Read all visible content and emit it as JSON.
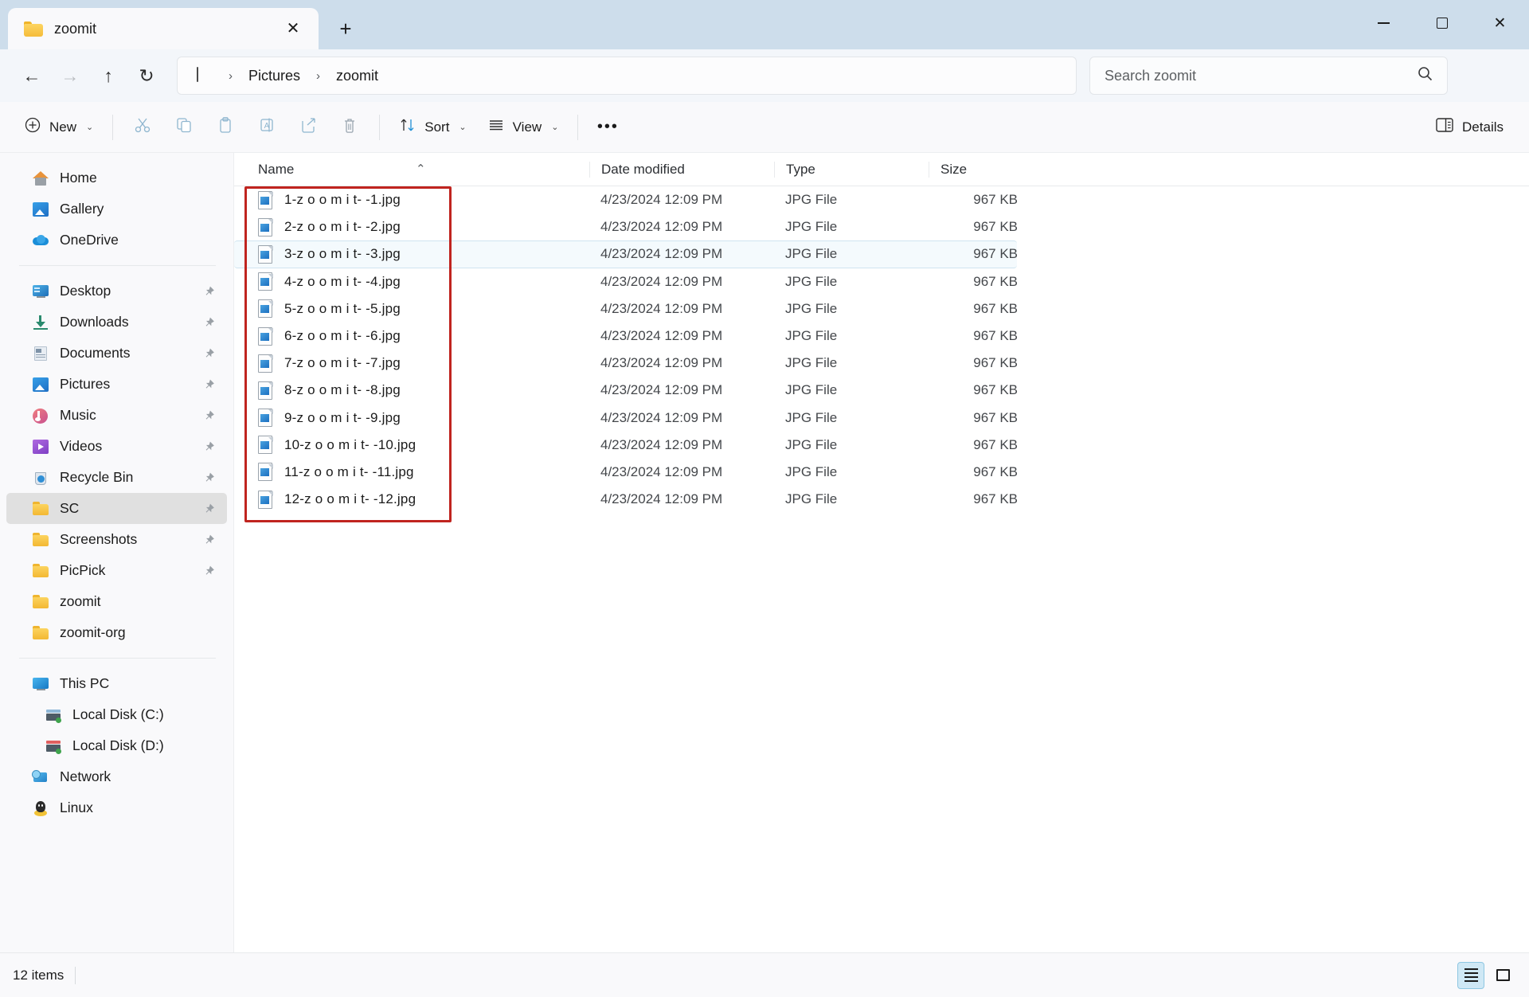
{
  "window": {
    "tab_title": "zoomit",
    "tab_icon": "folder-icon",
    "close_tab_label": "✕",
    "new_tab_label": "+",
    "minimize_label": "minimize",
    "maximize_label": "maximize",
    "close_label": "✕"
  },
  "address": {
    "back_label": "←",
    "forward_label": "→",
    "up_label": "↑",
    "refresh_label": "↻",
    "root_icon": "monitor-icon",
    "breadcrumbs": [
      "Pictures",
      "zoomit"
    ],
    "separator": "›"
  },
  "search": {
    "placeholder": "Search zoomit",
    "icon": "search-icon"
  },
  "toolbar": {
    "new_label": "New",
    "cut_label": "Cut",
    "copy_label": "Copy",
    "paste_label": "Paste",
    "rename_label": "Rename",
    "share_label": "Share",
    "delete_label": "Delete",
    "sort_label": "Sort",
    "view_label": "View",
    "more_label": "•••",
    "details_label": "Details",
    "chevron": "⌄"
  },
  "sidebar": {
    "groups": [
      {
        "items": [
          {
            "label": "Home",
            "icon": "home-icon",
            "pinned": false,
            "selected": false
          },
          {
            "label": "Gallery",
            "icon": "gallery-icon",
            "pinned": false,
            "selected": false
          },
          {
            "label": "OneDrive",
            "icon": "onedrive-icon",
            "pinned": false,
            "selected": false
          }
        ]
      },
      {
        "items": [
          {
            "label": "Desktop",
            "icon": "desktop-icon",
            "pinned": true,
            "selected": false
          },
          {
            "label": "Downloads",
            "icon": "downloads-icon",
            "pinned": true,
            "selected": false
          },
          {
            "label": "Documents",
            "icon": "documents-icon",
            "pinned": true,
            "selected": false
          },
          {
            "label": "Pictures",
            "icon": "pictures-icon",
            "pinned": true,
            "selected": false
          },
          {
            "label": "Music",
            "icon": "music-icon",
            "pinned": true,
            "selected": false
          },
          {
            "label": "Videos",
            "icon": "videos-icon",
            "pinned": true,
            "selected": false
          },
          {
            "label": "Recycle Bin",
            "icon": "recycle-bin-icon",
            "pinned": true,
            "selected": false
          },
          {
            "label": "SC",
            "icon": "folder-icon",
            "pinned": true,
            "selected": true
          },
          {
            "label": "Screenshots",
            "icon": "folder-icon",
            "pinned": true,
            "selected": false
          },
          {
            "label": "PicPick",
            "icon": "folder-icon",
            "pinned": true,
            "selected": false
          },
          {
            "label": "zoomit",
            "icon": "folder-icon",
            "pinned": false,
            "selected": false
          },
          {
            "label": "zoomit-org",
            "icon": "folder-icon",
            "pinned": false,
            "selected": false
          }
        ]
      },
      {
        "items": [
          {
            "label": "This PC",
            "icon": "this-pc-icon",
            "pinned": false,
            "selected": false,
            "indent": false
          },
          {
            "label": "Local Disk (C:)",
            "icon": "disk-c-icon",
            "pinned": false,
            "selected": false,
            "indent": true
          },
          {
            "label": "Local Disk (D:)",
            "icon": "disk-d-icon",
            "pinned": false,
            "selected": false,
            "indent": true
          },
          {
            "label": "Network",
            "icon": "network-icon",
            "pinned": false,
            "selected": false,
            "indent": false
          },
          {
            "label": "Linux",
            "icon": "linux-icon",
            "pinned": false,
            "selected": false,
            "indent": false
          }
        ]
      }
    ]
  },
  "filelist": {
    "columns": [
      "Name",
      "Date modified",
      "Type",
      "Size"
    ],
    "sort_caret": "⌃",
    "rows": [
      {
        "name": "1-z o o m i t- -1.jpg",
        "date": "4/23/2024 12:09 PM",
        "type": "JPG File",
        "size": "967 KB",
        "hovered": false
      },
      {
        "name": "2-z o o m i t- -2.jpg",
        "date": "4/23/2024 12:09 PM",
        "type": "JPG File",
        "size": "967 KB",
        "hovered": false
      },
      {
        "name": "3-z o o m i t- -3.jpg",
        "date": "4/23/2024 12:09 PM",
        "type": "JPG File",
        "size": "967 KB",
        "hovered": true
      },
      {
        "name": "4-z o o m i t- -4.jpg",
        "date": "4/23/2024 12:09 PM",
        "type": "JPG File",
        "size": "967 KB",
        "hovered": false
      },
      {
        "name": "5-z o o m i t- -5.jpg",
        "date": "4/23/2024 12:09 PM",
        "type": "JPG File",
        "size": "967 KB",
        "hovered": false
      },
      {
        "name": "6-z o o m i t- -6.jpg",
        "date": "4/23/2024 12:09 PM",
        "type": "JPG File",
        "size": "967 KB",
        "hovered": false
      },
      {
        "name": "7-z o o m i t- -7.jpg",
        "date": "4/23/2024 12:09 PM",
        "type": "JPG File",
        "size": "967 KB",
        "hovered": false
      },
      {
        "name": "8-z o o m i t- -8.jpg",
        "date": "4/23/2024 12:09 PM",
        "type": "JPG File",
        "size": "967 KB",
        "hovered": false
      },
      {
        "name": "9-z o o m i t- -9.jpg",
        "date": "4/23/2024 12:09 PM",
        "type": "JPG File",
        "size": "967 KB",
        "hovered": false
      },
      {
        "name": "10-z o o m i t- -10.jpg",
        "date": "4/23/2024 12:09 PM",
        "type": "JPG File",
        "size": "967 KB",
        "hovered": false
      },
      {
        "name": "11-z o o m i t- -11.jpg",
        "date": "4/23/2024 12:09 PM",
        "type": "JPG File",
        "size": "967 KB",
        "hovered": false
      },
      {
        "name": "12-z o o m i t- -12.jpg",
        "date": "4/23/2024 12:09 PM",
        "type": "JPG File",
        "size": "967 KB",
        "hovered": false
      }
    ]
  },
  "annotation": {
    "color": "#c0241f",
    "shape": "rectangle"
  },
  "status": {
    "item_count": "12 items",
    "details_view_label": "Details view",
    "large_icons_view_label": "Large icons view"
  },
  "colors": {
    "titlebar_bg": "#cdddeb",
    "accent": "#0f6cbd",
    "folder_yellow": "#f5bc3a",
    "selection_gray": "#e0e0e0",
    "hover_blue": "#f4fafd",
    "annotation_red": "#c0241f"
  }
}
